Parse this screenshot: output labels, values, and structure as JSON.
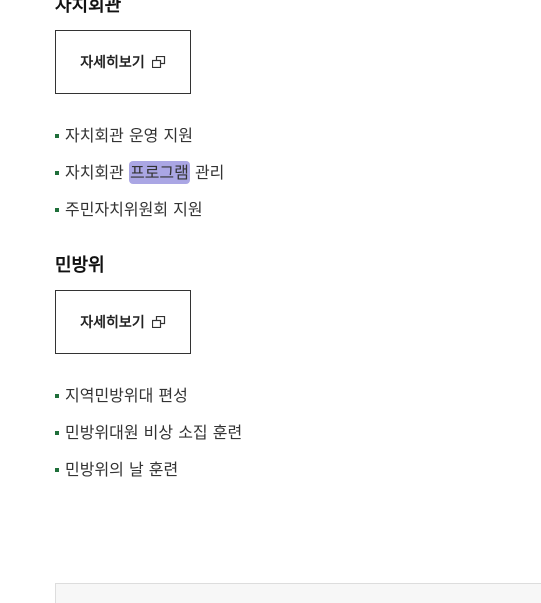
{
  "sections": [
    {
      "title": "자치회관",
      "button_label": "자세히보기",
      "items": [
        {
          "text": "자치회관 운영 지원"
        },
        {
          "prefix": "자치회관 ",
          "highlight": "프로그램",
          "suffix": " 관리"
        },
        {
          "text": "주민자치위원회 지원"
        }
      ]
    },
    {
      "title": "민방위",
      "button_label": "자세히보기",
      "items": [
        {
          "text": "지역민방위대 편성"
        },
        {
          "text": "민방위대원 비상 소집 훈련"
        },
        {
          "text": "민방위의 날 훈련"
        }
      ]
    }
  ],
  "colors": {
    "bullet": "#1f6f3a",
    "highlight": "#aaa6e4"
  },
  "icons": {
    "button_icon": "new-window-icon"
  }
}
